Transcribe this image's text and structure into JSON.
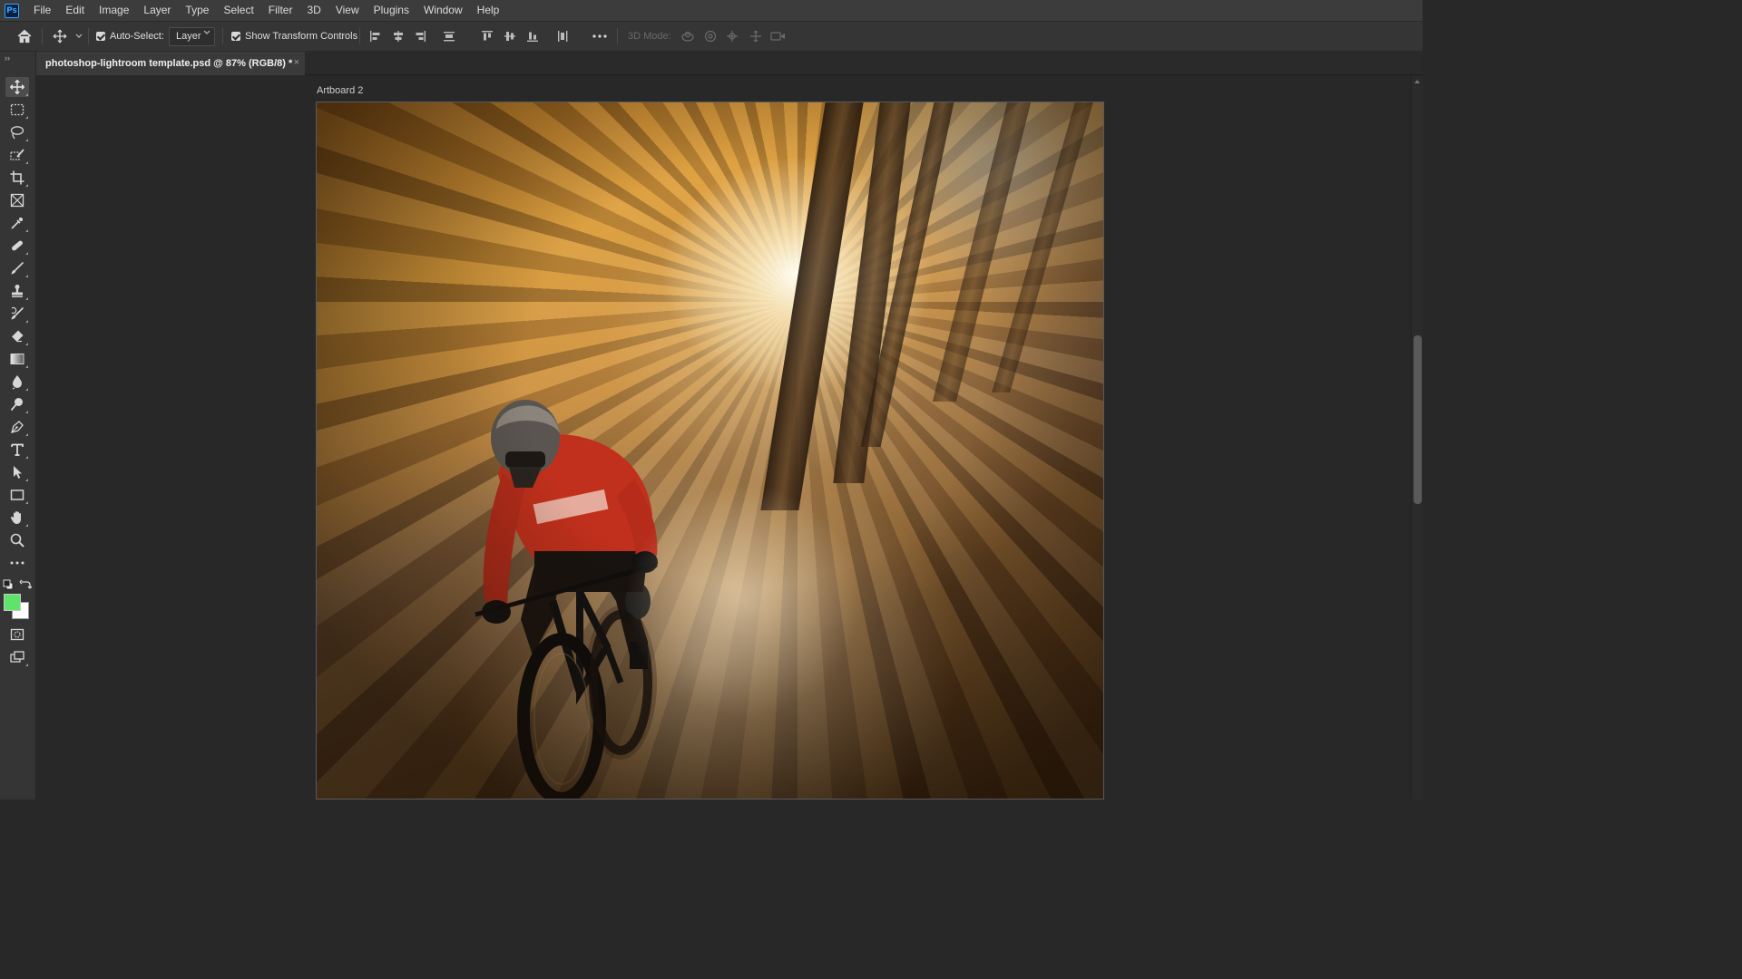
{
  "app": {
    "logo_text": "Ps"
  },
  "menu": [
    "File",
    "Edit",
    "Image",
    "Layer",
    "Type",
    "Select",
    "Filter",
    "3D",
    "View",
    "Plugins",
    "Window",
    "Help"
  ],
  "options_bar": {
    "auto_select_label": "Auto-Select:",
    "auto_select_checked": true,
    "layer_dropdown_value": "Layer",
    "show_transform_label": "Show Transform Controls",
    "show_transform_checked": true,
    "three_d_mode_label": "3D Mode:"
  },
  "document": {
    "tab_title": "photoshop-lightroom template.psd @ 87% (RGB/8) *",
    "close_glyph": "×",
    "zoom_percent": 87,
    "color_mode": "RGB/8"
  },
  "canvas": {
    "artboard_label": "Artboard 2",
    "image_subject": "mountain biker riding down a forest trail with radial motion blur and sunlight through trees"
  },
  "tools": [
    {
      "name": "move-tool",
      "active": true
    },
    {
      "name": "rectangular-marquee-tool"
    },
    {
      "name": "lasso-tool"
    },
    {
      "name": "object-selection-tool"
    },
    {
      "name": "crop-tool"
    },
    {
      "name": "frame-tool"
    },
    {
      "name": "eyedropper-tool"
    },
    {
      "name": "spot-healing-brush-tool"
    },
    {
      "name": "brush-tool"
    },
    {
      "name": "clone-stamp-tool"
    },
    {
      "name": "history-brush-tool"
    },
    {
      "name": "eraser-tool"
    },
    {
      "name": "gradient-tool"
    },
    {
      "name": "blur-tool"
    },
    {
      "name": "dodge-tool"
    },
    {
      "name": "pen-tool"
    },
    {
      "name": "type-tool"
    },
    {
      "name": "path-selection-tool"
    },
    {
      "name": "rectangle-tool"
    },
    {
      "name": "hand-tool"
    },
    {
      "name": "zoom-tool"
    },
    {
      "name": "edit-toolbar"
    }
  ],
  "colors": {
    "foreground": "#5ee36b",
    "background": "#ffffff",
    "ui_dark": "#282828",
    "ui_panel": "#353535",
    "menubar": "#3c3c3c",
    "accent_blue": "#31a8ff"
  }
}
